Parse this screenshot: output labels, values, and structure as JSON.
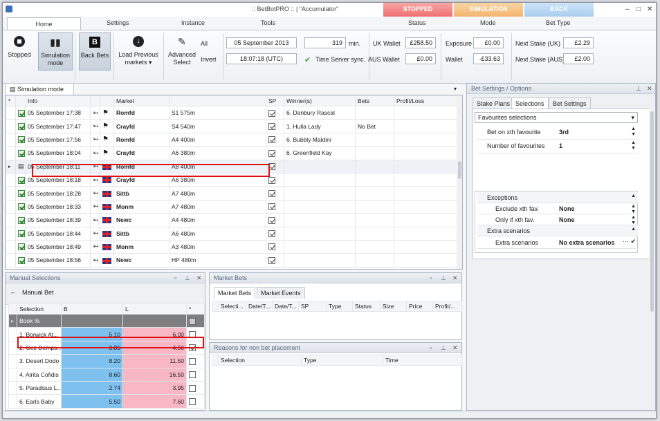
{
  "app": {
    "title": ":: BetBotPRO :: | \"Accumulator\""
  },
  "mode_buttons": {
    "stopped": "STOPPED",
    "simulation": "SIMULATION",
    "back": "BACK"
  },
  "mode_labels": {
    "status": "Status",
    "mode": "Mode",
    "bet_type": "Bet Type"
  },
  "tabs": [
    "Home",
    "Settings",
    "Instance",
    "Tools"
  ],
  "ribbon": {
    "stopped": "Stopped",
    "simulation": "Simulation mode",
    "back_bets": "Back Bets",
    "load_prev": "Load Previous markets",
    "adv_select": "Advanced Select",
    "all": "All",
    "invert": "Invert",
    "date": "05 September 2013",
    "time": "18:07:18 (UTC)",
    "minutes_value": "319",
    "minutes_unit": "min.",
    "time_sync": "Time Server sync.",
    "uk_wallet_label": "UK Wallet",
    "uk_wallet": "£258.50",
    "aus_wallet_label": "AUS Wallet",
    "aus_wallet": "£0.00",
    "exposure_label": "Exposure",
    "exposure": "£0.00",
    "wallet_label": "Wallet",
    "wallet": "-£33.63",
    "next_uk_label": "Next Stake (UK)",
    "next_uk": "£2.29",
    "next_aus_label": "Next Stake (AUS)",
    "next_aus": "£2.00"
  },
  "sim_tab": "Simulation mode",
  "markets": {
    "headers": [
      "*",
      "Info",
      "",
      "",
      "Market",
      "",
      "SP",
      "Winner(s)",
      "Bets",
      "Profit/Loss"
    ],
    "rows": [
      {
        "info": "05 September 17:38",
        "venue": "Romfd",
        "race": "S1 575m",
        "winner": "6. Danbury Rascal",
        "bets": "",
        "chequered": true
      },
      {
        "info": "05 September 17:47",
        "venue": "Crayfd",
        "race": "S4 540m",
        "winner": "1. Hulla Lady",
        "bets": "No Bet",
        "chequered": true
      },
      {
        "info": "05 September 17:56",
        "venue": "Romfd",
        "race": "A4 400m",
        "winner": "6. Bubbly Maldini",
        "bets": "",
        "chequered": true
      },
      {
        "info": "05 September 18:04",
        "venue": "Crayfd",
        "race": "A6 380m",
        "winner": "6. Greenfield Kay",
        "bets": "",
        "chequered": true
      },
      {
        "info": "05 September 18:11",
        "venue": "Romfd",
        "race": "A8 400m",
        "winner": "",
        "bets": "",
        "chequered": false
      },
      {
        "info": "05 September 18:18",
        "venue": "Crayfd",
        "race": "A6 380m",
        "winner": "",
        "bets": "",
        "chequered": false
      },
      {
        "info": "05 September 18:28",
        "venue": "Sittb",
        "race": "A7 480m",
        "winner": "",
        "bets": "",
        "chequered": false
      },
      {
        "info": "05 September 18:33",
        "venue": "Monm",
        "race": "A7 480m",
        "winner": "",
        "bets": "",
        "chequered": false
      },
      {
        "info": "05 September 18:39",
        "venue": "Newc",
        "race": "A4 480m",
        "winner": "",
        "bets": "",
        "chequered": false
      },
      {
        "info": "05 September 18:44",
        "venue": "Sittb",
        "race": "A6 480m",
        "winner": "",
        "bets": "",
        "chequered": false
      },
      {
        "info": "05 September 18:49",
        "venue": "Monm",
        "race": "A3 480m",
        "winner": "",
        "bets": "",
        "chequered": false
      },
      {
        "info": "05 September 18:56",
        "venue": "Newc",
        "race": "HP 480m",
        "winner": "",
        "bets": "",
        "chequered": false
      }
    ]
  },
  "manual_sel": {
    "title": "Manual Selections",
    "group": "Manual Bet",
    "headers": [
      "Selection",
      "B",
      "L",
      "*"
    ],
    "book": "Book %",
    "rows": [
      {
        "name": "1. Borwick At...",
        "b": "5.10",
        "l": "6.00",
        "checked": false
      },
      {
        "name": "2. Gez Demps...",
        "b": "3.85",
        "l": "4.50",
        "checked": true
      },
      {
        "name": "3. Desert Dodo",
        "b": "8.20",
        "l": "11.50",
        "checked": false
      },
      {
        "name": "4. Alrita Cofidis",
        "b": "8.60",
        "l": "16.50",
        "checked": false
      },
      {
        "name": "5. Paradisus L...",
        "b": "2.74",
        "l": "3.95",
        "checked": false
      },
      {
        "name": "6. Earls Baby",
        "b": "5.50",
        "l": "7.60",
        "checked": false
      }
    ]
  },
  "market_bets": {
    "title": "Market Bets",
    "tabs": [
      "Market Bets",
      "Market Events"
    ],
    "headers": [
      "Selecti...",
      "Date/T...",
      "Date/T...",
      "SP",
      "Type",
      "Status",
      "Size",
      "Price",
      "Profit/..."
    ]
  },
  "reasons": {
    "title": "Reasons for non bet placement",
    "headers": [
      "Selection",
      "Type",
      "Time"
    ]
  },
  "bet_settings": {
    "title": "Bet Settings / Options",
    "tabs": [
      "Stake Plans",
      "Selections",
      "Bet Settings"
    ],
    "dropdown": "Favourites selections",
    "opts": [
      {
        "k": "Bet on xth favourite",
        "v": "3rd"
      },
      {
        "k": "Number of favourites",
        "v": "1"
      }
    ],
    "exceptions": "Exceptions",
    "exc": [
      {
        "k": "Exclude xth fav.",
        "v": "None"
      },
      {
        "k": "Only if xth fav.",
        "v": "None"
      }
    ],
    "extra": "Extra scenarios",
    "extra_row": {
      "k": "Extra scenarios",
      "v": "No extra scenarios"
    }
  }
}
